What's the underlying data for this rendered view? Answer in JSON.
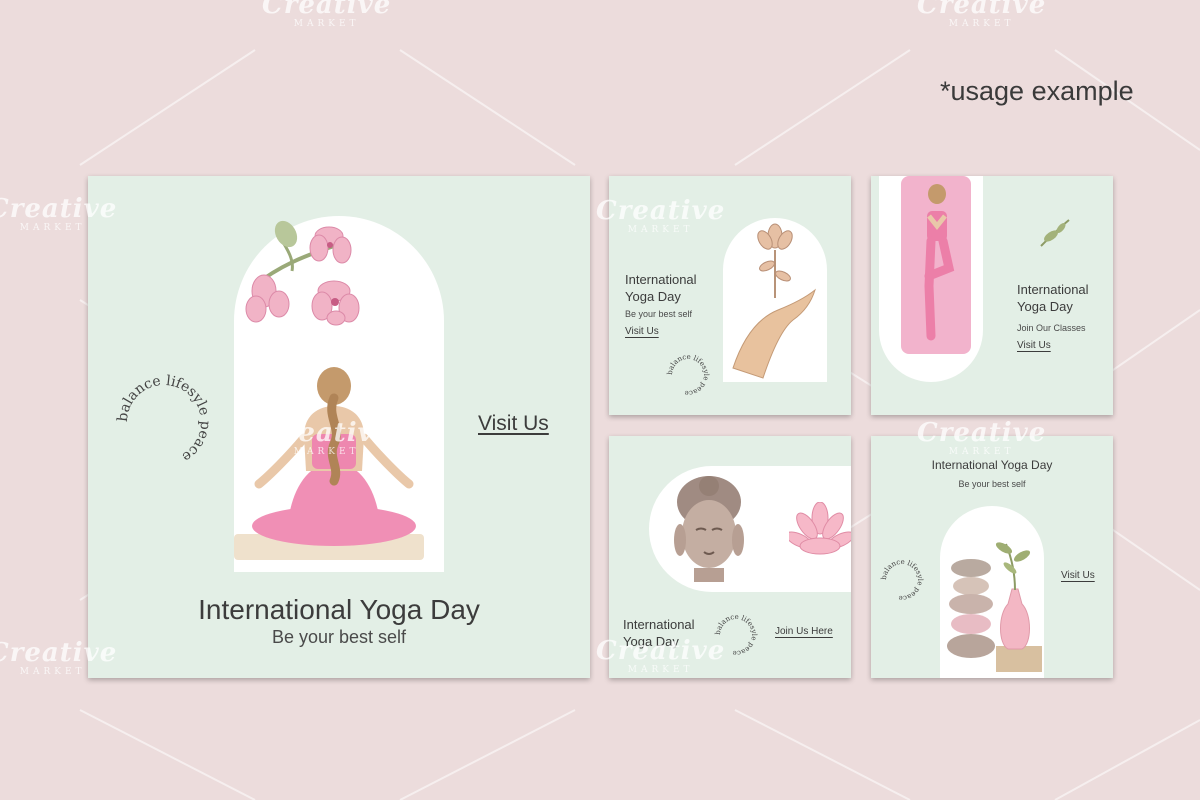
{
  "watermark": {
    "brand": "Creative",
    "sub": "MARKET"
  },
  "usage_note": "*usage example",
  "cards": {
    "main": {
      "title": "International Yoga Day",
      "subtitle": "Be your best self",
      "link": "Visit Us",
      "circle_text": "balance lifesyle peace"
    },
    "top_middle": {
      "title_line1": "International",
      "title_line2": "Yoga Day",
      "subtitle": "Be your best self",
      "link": "Visit Us",
      "circle_text": "balance lifesyle peace"
    },
    "top_right": {
      "title_line1": "International",
      "title_line2": "Yoga Day",
      "subtitle": "Join Our Classes",
      "link": "Visit Us"
    },
    "bottom_middle": {
      "title_line1": "International",
      "title_line2": "Yoga Day",
      "link": "Join Us Here",
      "circle_text": "balance lifesyle peace"
    },
    "bottom_right": {
      "title": "International Yoga Day",
      "subtitle": "Be your best self",
      "link": "Visit Us",
      "circle_text": "balance lifesyle peace"
    }
  },
  "colors": {
    "background": "#ecdcdc",
    "card": "#e3efe6",
    "pink": "#f0a3bf",
    "text": "#3c3c3c"
  }
}
